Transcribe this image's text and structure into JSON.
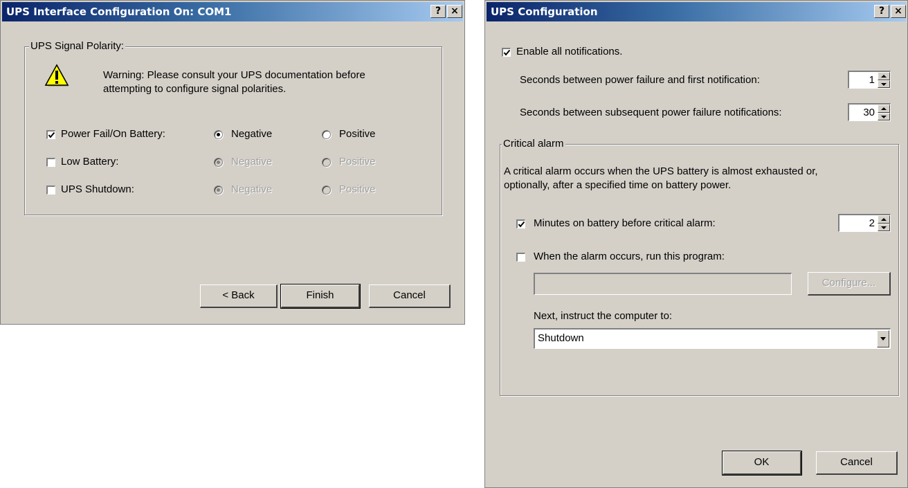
{
  "dialog1": {
    "title": "UPS Interface Configuration On: COM1",
    "help_btn": "?",
    "close_btn": "×",
    "group_label": "UPS Signal Polarity:",
    "warning_line1": "Warning: Please consult your UPS documentation before",
    "warning_line2": "attempting to configure signal polarities.",
    "rows": [
      {
        "label": "Power Fail/On Battery:",
        "checked": true,
        "negative": "Negative",
        "positive": "Positive",
        "enabled": true
      },
      {
        "label": "Low Battery:",
        "checked": false,
        "negative": "Negative",
        "positive": "Positive",
        "enabled": false
      },
      {
        "label": "UPS Shutdown:",
        "checked": false,
        "negative": "Negative",
        "positive": "Positive",
        "enabled": false
      }
    ],
    "back_label": "< Back",
    "finish_label": "Finish",
    "cancel_label": "Cancel"
  },
  "dialog2": {
    "title": "UPS Configuration",
    "help_btn": "?",
    "close_btn": "×",
    "enable_label": "Enable all notifications.",
    "first_notif_label": "Seconds between power failure and first notification:",
    "first_notif_value": "1",
    "subsequent_label": "Seconds between subsequent power failure notifications:",
    "subsequent_value": "30",
    "critical_group_label": "Critical alarm",
    "critical_desc_line1": "A critical alarm occurs when the UPS battery is almost exhausted or,",
    "critical_desc_line2": "optionally, after a specified time on battery power.",
    "minutes_label": "Minutes on battery before critical alarm:",
    "minutes_value": "2",
    "run_program_label": "When the alarm occurs, run this program:",
    "program_path": "",
    "configure_label": "Configure...",
    "next_label": "Next, instruct the computer to:",
    "action_value": "Shutdown",
    "ok_label": "OK",
    "cancel_label": "Cancel"
  }
}
